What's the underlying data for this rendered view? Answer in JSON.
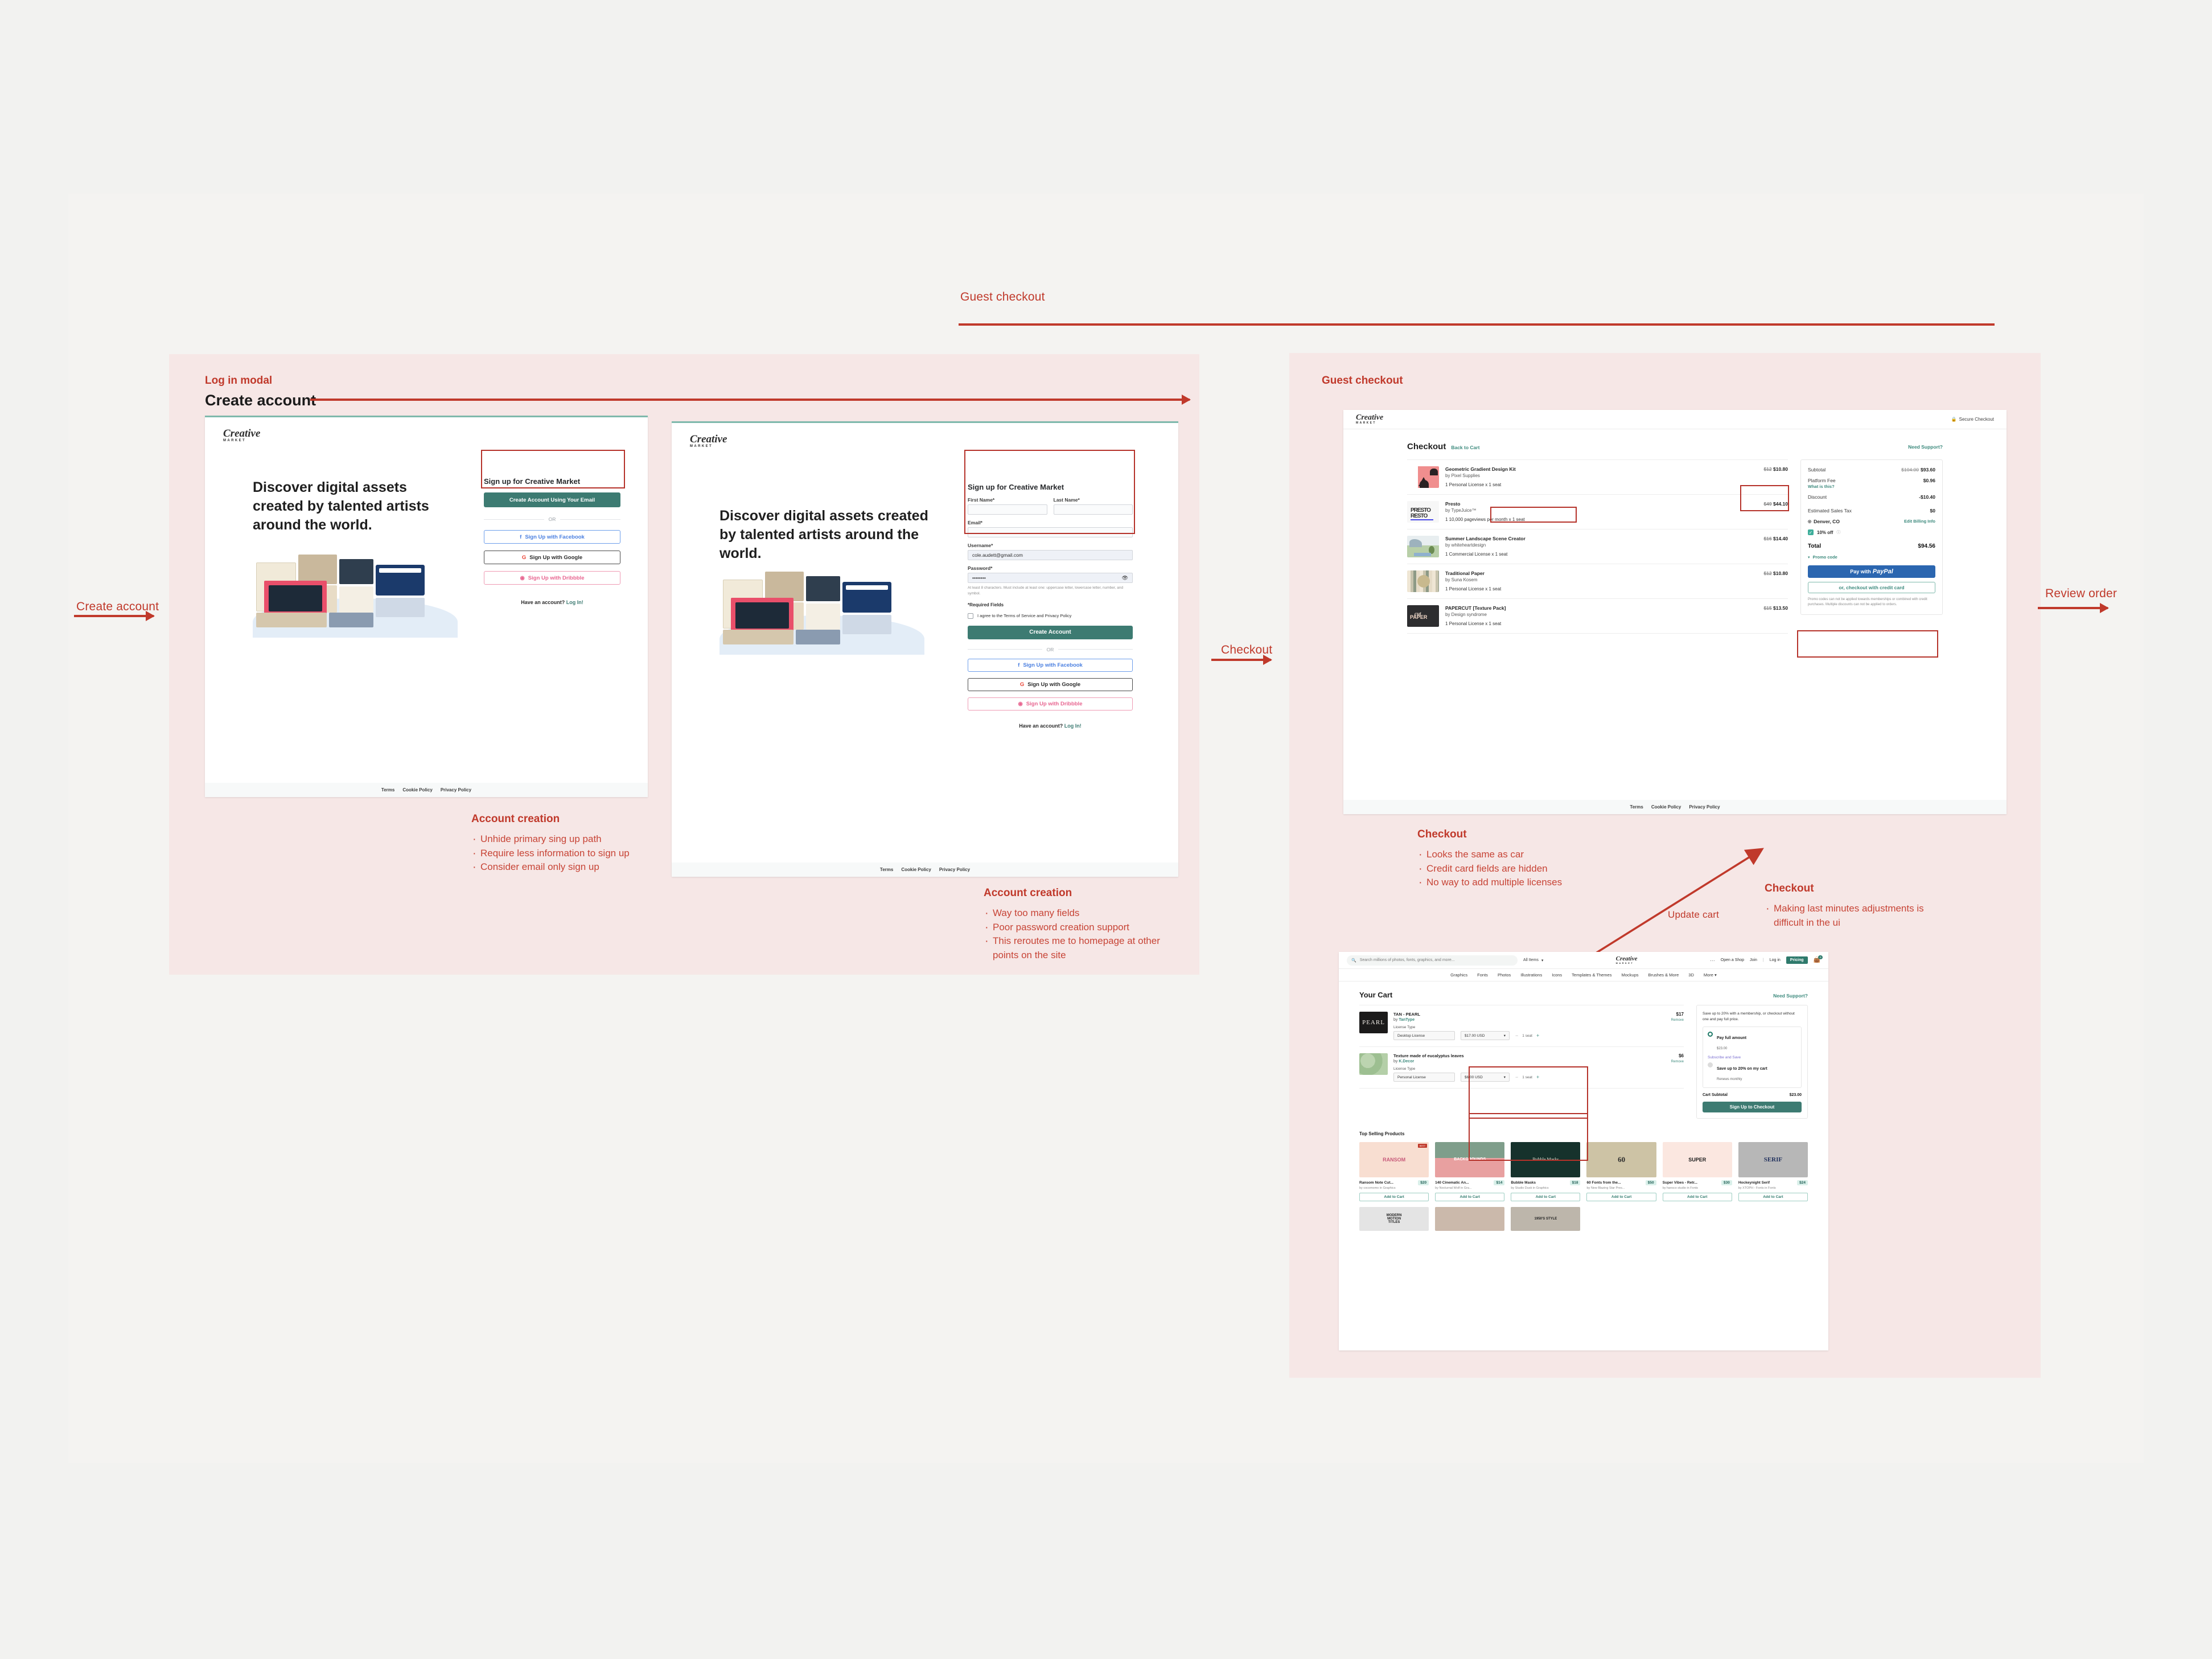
{
  "board": {
    "top_flow_label": "Guest checkout",
    "arrows": [
      {
        "name": "create-account",
        "label": "Create account"
      },
      {
        "name": "checkout",
        "label": "Checkout"
      },
      {
        "name": "review-order",
        "label": "Review order"
      },
      {
        "name": "update-cart",
        "label": "Update cart"
      }
    ]
  },
  "panel_left": {
    "label": "Log in modal",
    "title": "Create account"
  },
  "panel_right": {
    "label": "Guest checkout"
  },
  "signup_a": {
    "logo": "Creative",
    "logo_sub": "MARKET",
    "hero": "Discover digital assets created by talented artists around the world.",
    "form_head": "Sign up for Creative Market",
    "email_cta": "Create Account Using Your Email",
    "or": "OR",
    "facebook": "Sign Up with Facebook",
    "google": "Sign Up with Google",
    "dribbble": "Sign Up with Dribbble",
    "have_account": "Have an account?",
    "login_link": "Log In!",
    "footer": [
      "Terms",
      "Cookie Policy",
      "Privacy Policy"
    ]
  },
  "signup_b": {
    "logo": "Creative",
    "logo_sub": "MARKET",
    "hero": "Discover digital assets created by talented artists around the world.",
    "form_head": "Sign up for Creative Market",
    "first_name_label": "First Name*",
    "first_name_value": "",
    "last_name_label": "Last Name*",
    "last_name_value": "",
    "email_label": "Email*",
    "email_value": "",
    "username_label": "Username*",
    "username_value": "cole.audett@gmail.com",
    "password_label": "Password*",
    "password_value": "••••••••",
    "password_hint": "At least 8 characters. Must include at least one: uppercase letter, lowercase letter, number, and symbol.",
    "required_note": "*Required Fields",
    "tos_text": "I agree to the Terms of Service and Privacy Policy",
    "create_cta": "Create Account",
    "or": "OR",
    "facebook": "Sign Up with Facebook",
    "google": "Sign Up with Google",
    "dribbble": "Sign Up with Dribbble",
    "have_account": "Have an account?",
    "login_link": "Log In!",
    "footer": [
      "Terms",
      "Cookie Policy",
      "Privacy Policy"
    ]
  },
  "notes": [
    {
      "name": "account-creation-a",
      "title": "Account creation",
      "items": [
        "Unhide primary sing up path",
        "Require less information to sign up",
        "Consider email only sign up"
      ]
    },
    {
      "name": "account-creation-b",
      "title": "Account creation",
      "items": [
        "Way too many fields",
        "Poor password creation support",
        "This reroutes me to homepage at other points on the site"
      ]
    },
    {
      "name": "checkout-a",
      "title": "Checkout",
      "items": [
        "Looks the same as car",
        "Credit card fields are hidden",
        "No way to add multiple licenses"
      ]
    },
    {
      "name": "checkout-b",
      "title": "Checkout",
      "items": [
        "Making last minutes adjustments is difficult in the ui"
      ]
    }
  ],
  "checkout": {
    "logo": "Creative",
    "logo_sub": "MARKET",
    "secure": "Secure Checkout",
    "title": "Checkout",
    "back_to_cart": "Back to Cart",
    "need_support": "Need Support?",
    "items": [
      {
        "name": "Geometric Gradient Design Kit",
        "by": "by Pixel Supplies",
        "license": "1 Personal License x 1 seat",
        "was": "$12",
        "now": "$10.80",
        "thumb": "geometric"
      },
      {
        "name": "Presto",
        "by": "by TypeJuice™",
        "license": "1 10,000 pageviews per month x 1 seat",
        "was": "$49",
        "now": "$44.10",
        "thumb": "presto"
      },
      {
        "name": "Summer Landscape Scene Creator",
        "by": "by whiteheartdesign",
        "license": "1 Commercial License x 1 seat",
        "was": "$16",
        "now": "$14.40",
        "thumb": "landscape"
      },
      {
        "name": "Traditional Paper",
        "by": "by Suna Kosem",
        "license": "1 Personal License x 1 seat",
        "was": "$12",
        "now": "$10.80",
        "thumb": "paper"
      },
      {
        "name": "PAPERCUT [Texture Pack]",
        "by": "by Design syndrome",
        "license": "1 Personal License x 1 seat",
        "was": "$15",
        "now": "$13.50",
        "thumb": "papercut"
      }
    ],
    "summary": {
      "subtotal_label": "Subtotal",
      "subtotal_was": "$104.00",
      "subtotal_now": "$93.60",
      "platform_fee_label": "Platform Fee",
      "platform_fee_sub": "What is this?",
      "platform_fee_value": "$0.96",
      "discount_label": "Discount",
      "discount_value": "-$10.40",
      "tax_label": "Estimated Sales Tax",
      "tax_value": "$0",
      "location": "Denver, CO",
      "edit_billing": "Edit Billing Info",
      "discount_badge": "10% off",
      "total_label": "Total",
      "total_value": "$94.56",
      "promo_code": "Promo code",
      "paypal_pre": "Pay with",
      "paypal_brand": "PayPal",
      "credit_card": "or, checkout with credit card",
      "fineprint": "Promo codes can not be applied towards memberships or combined with credit purchases. Multiple discounts can not be applied to orders."
    },
    "footer": [
      "Terms",
      "Cookie Policy",
      "Privacy Policy"
    ]
  },
  "cart": {
    "search_placeholder": "Search millions of photos, fonts, graphics, and more...",
    "all_items": "All Items",
    "logo": "Creative",
    "logo_sub": "MARKET",
    "open_shop": "Open a Shop",
    "join": "Join",
    "login": "Log in",
    "pricing": "Pricing",
    "cart_count": "0",
    "nav": [
      "Graphics",
      "Fonts",
      "Photos",
      "Illustrations",
      "Icons",
      "Templates & Themes",
      "Mockups",
      "Brushes & More",
      "3D",
      "More"
    ],
    "title": "Your Cart",
    "need_support": "Need Support?",
    "items": [
      {
        "name": "TAN - PEARL",
        "by_pre": "by",
        "by": "TanType",
        "license_label": "License Type",
        "license": "Desktop License",
        "price_sel": "$17.00 USD",
        "seats": "1 seat",
        "price": "$17",
        "remove": "Remove",
        "thumb": "pearl"
      },
      {
        "name": "Texture made of eucalyptus leaves",
        "by_pre": "by",
        "by": "K.Decor",
        "license_label": "License Type",
        "license": "Personal License",
        "price_sel": "$6.00 USD",
        "seats": "1 seat",
        "price": "$6",
        "remove": "Remove",
        "thumb": "eucalyptus"
      }
    ],
    "promo": {
      "headline": "Save up to 20% with a membership, or checkout without one and pay full price.",
      "pay_full": "Pay full amount",
      "pay_full_amount": "$23.00",
      "subscribe_save": "Subscribe and Save",
      "save_option": "Save up to 20% on my cart",
      "renews": "Renews monthly",
      "subtotal_label": "Cart Subtotal",
      "subtotal_value": "$23.00",
      "checkout_cta": "Sign Up to Checkout"
    },
    "top_selling_title": "Top Selling Products",
    "products": [
      {
        "name": "Ransom Note Cut...",
        "price": "$20",
        "by": "by cocomomo in Graphics",
        "cta": "Add to Cart",
        "thumb": "ransom"
      },
      {
        "name": "140 Cinematic An...",
        "price": "$14",
        "by": "by Nocturnal Wolf in Gra...",
        "cta": "Add to Cart",
        "thumb": "cinematic"
      },
      {
        "name": "Bubble Masks",
        "price": "$18",
        "by": "by Studio Dusk in Graphics",
        "cta": "Add to Cart",
        "thumb": "bubble"
      },
      {
        "name": "60 Fonts from the...",
        "price": "$50",
        "by": "by New Blazing Star Pres...",
        "cta": "Add to Cart",
        "thumb": "civilwar"
      },
      {
        "name": "Super Vibes - Retr...",
        "price": "$30",
        "by": "by hansco studio in Fonts",
        "cta": "Add to Cart",
        "thumb": "supervibes"
      },
      {
        "name": "Hockeynight Serif",
        "price": "$24",
        "by": "by XTOPH - Fonts in Fonts",
        "cta": "Add to Cart",
        "thumb": "serif"
      }
    ],
    "products_row2": [
      {
        "thumb": "modern"
      },
      {
        "thumb": "subscription"
      },
      {
        "thumb": "retroads"
      }
    ]
  }
}
